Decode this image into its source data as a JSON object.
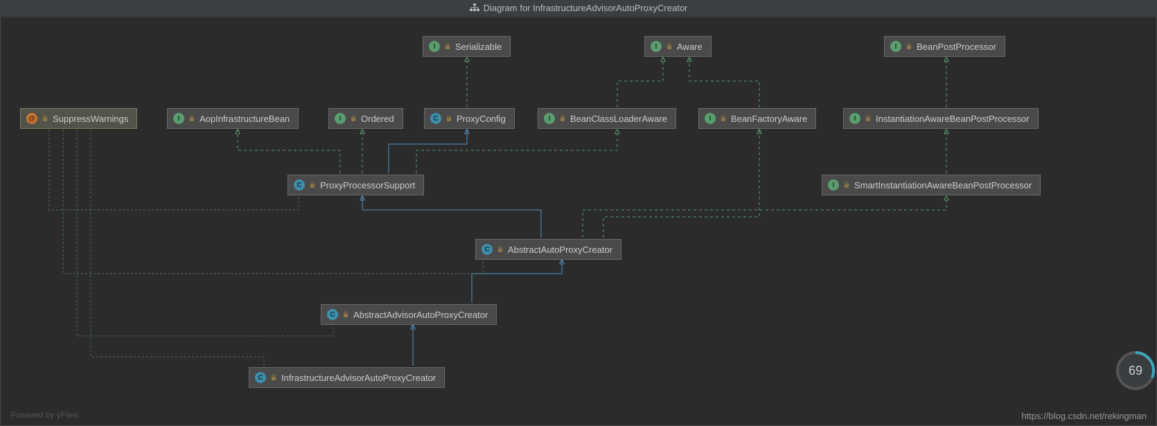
{
  "title": "Diagram for InfrastructureAdvisorAutoProxyCreator",
  "footer_left": "Powered by yFiles",
  "footer_right": "https://blog.csdn.net/rekingman",
  "progress": "69",
  "nodes": {
    "suppress": {
      "label": "SuppressWarnings",
      "kind": "A"
    },
    "aopinfra": {
      "label": "AopInfrastructureBean",
      "kind": "I"
    },
    "ordered": {
      "label": "Ordered",
      "kind": "I"
    },
    "serializable": {
      "label": "Serializable",
      "kind": "I"
    },
    "proxyconfig": {
      "label": "ProxyConfig",
      "kind": "C"
    },
    "aware": {
      "label": "Aware",
      "kind": "I"
    },
    "bclaware": {
      "label": "BeanClassLoaderAware",
      "kind": "I"
    },
    "bfaware": {
      "label": "BeanFactoryAware",
      "kind": "I"
    },
    "bpp": {
      "label": "BeanPostProcessor",
      "kind": "I"
    },
    "iabpp": {
      "label": "InstantiationAwareBeanPostProcessor",
      "kind": "I"
    },
    "siabpp": {
      "label": "SmartInstantiationAwareBeanPostProcessor",
      "kind": "I"
    },
    "pps": {
      "label": "ProxyProcessorSupport",
      "kind": "C"
    },
    "aapc": {
      "label": "AbstractAutoProxyCreator",
      "kind": "C"
    },
    "aaapc": {
      "label": "AbstractAdvisorAutoProxyCreator",
      "kind": "C"
    },
    "iaapc": {
      "label": "InfrastructureAdvisorAutoProxyCreator",
      "kind": "C"
    }
  }
}
